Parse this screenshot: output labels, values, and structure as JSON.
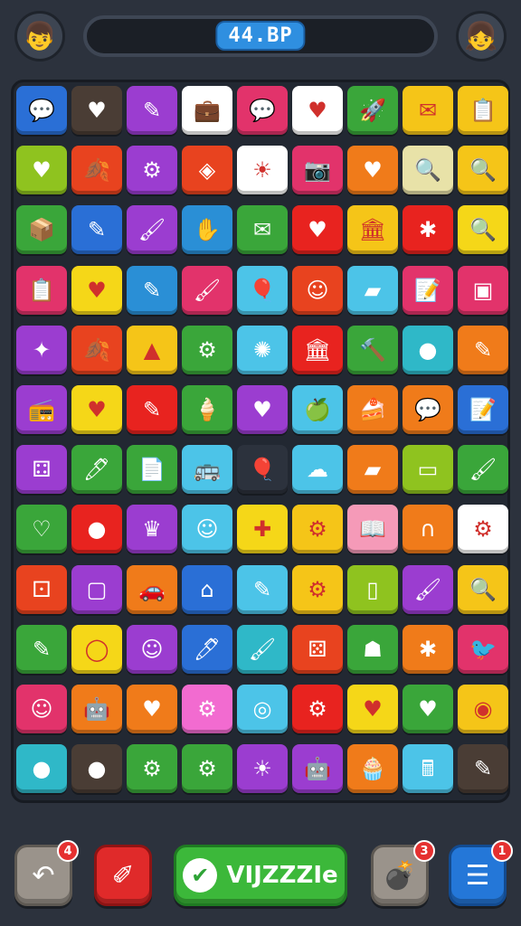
{
  "header": {
    "score": "44.BP",
    "left_avatar": "boy-avatar",
    "right_avatar": "girl-avatar"
  },
  "board": {
    "rows": [
      [
        {
          "color": "#2a6fd6",
          "icon": "speech-bubble-icon",
          "glyph": "💬"
        },
        {
          "color": "#4a3d35",
          "icon": "heart-icon",
          "glyph": "♥"
        },
        {
          "color": "#9b3dd0",
          "icon": "pencil-icon",
          "glyph": "✎"
        },
        {
          "color": "#ffffff",
          "icon": "briefcase-icon",
          "glyph": "💼"
        },
        {
          "color": "#e2336b",
          "icon": "speech-bubble-icon",
          "glyph": "💬"
        },
        {
          "color": "#ffffff",
          "icon": "heart-icon",
          "glyph": "♥"
        },
        {
          "color": "#3aa63a",
          "icon": "rocket-icon",
          "glyph": "🚀"
        },
        {
          "color": "#f5c518",
          "icon": "envelope-icon",
          "glyph": "✉"
        },
        {
          "color": "#f5c518",
          "icon": "clipboard-icon",
          "glyph": "📋"
        }
      ],
      [
        {
          "color": "#8fc31f",
          "icon": "heart-icon",
          "glyph": "♥"
        },
        {
          "color": "#e8431f",
          "icon": "leaf-icon",
          "glyph": "🍂"
        },
        {
          "color": "#9b3dd0",
          "icon": "gear-icon",
          "glyph": "⚙"
        },
        {
          "color": "#e8431f",
          "icon": "kite-icon",
          "glyph": "◈"
        },
        {
          "color": "#ffffff",
          "icon": "sun-icon",
          "glyph": "☀"
        },
        {
          "color": "#e2336b",
          "icon": "camera-icon",
          "glyph": "📷"
        },
        {
          "color": "#f07b1a",
          "icon": "heart-icon",
          "glyph": "♥"
        },
        {
          "color": "#e8e2a8",
          "icon": "magnifier-icon",
          "glyph": "🔍"
        },
        {
          "color": "#f5c518",
          "icon": "magnifier-icon",
          "glyph": "🔍"
        }
      ],
      [
        {
          "color": "#3aa63a",
          "icon": "box-icon",
          "glyph": "📦"
        },
        {
          "color": "#2a6fd6",
          "icon": "pencil-icon",
          "glyph": "✎"
        },
        {
          "color": "#9b3dd0",
          "icon": "brush-icon",
          "glyph": "🖌"
        },
        {
          "color": "#2a8fd6",
          "icon": "hand-icon",
          "glyph": "✋"
        },
        {
          "color": "#3aa63a",
          "icon": "envelope-icon",
          "glyph": "✉"
        },
        {
          "color": "#e8231f",
          "icon": "heart-icon",
          "glyph": "♥"
        },
        {
          "color": "#f5c518",
          "icon": "building-icon",
          "glyph": "🏛"
        },
        {
          "color": "#e8231f",
          "icon": "bug-icon",
          "glyph": "✱"
        },
        {
          "color": "#f5d718",
          "icon": "magnifier-icon",
          "glyph": "🔍"
        }
      ],
      [
        {
          "color": "#e2336b",
          "icon": "clipboard-icon",
          "glyph": "📋"
        },
        {
          "color": "#f5d718",
          "icon": "heart-icon",
          "glyph": "♥"
        },
        {
          "color": "#2a8fd6",
          "icon": "pencil-icon",
          "glyph": "✎"
        },
        {
          "color": "#e2336b",
          "icon": "brush-icon",
          "glyph": "🖌"
        },
        {
          "color": "#4cc4e8",
          "icon": "balloon-icon",
          "glyph": "🎈"
        },
        {
          "color": "#e8431f",
          "icon": "smiley-icon",
          "glyph": "☺"
        },
        {
          "color": "#4cc4e8",
          "icon": "eraser-icon",
          "glyph": "▰"
        },
        {
          "color": "#e2336b",
          "icon": "note-icon",
          "glyph": "📝"
        },
        {
          "color": "#e2336b",
          "icon": "card-icon",
          "glyph": "▣"
        }
      ],
      [
        {
          "color": "#9b3dd0",
          "icon": "star-burst-icon",
          "glyph": "✦"
        },
        {
          "color": "#e8431f",
          "icon": "leaf-icon",
          "glyph": "🍂"
        },
        {
          "color": "#f5c518",
          "icon": "horn-icon",
          "glyph": "▲"
        },
        {
          "color": "#3aa63a",
          "icon": "gear-icon",
          "glyph": "⚙"
        },
        {
          "color": "#4cc4e8",
          "icon": "satellite-icon",
          "glyph": "✺"
        },
        {
          "color": "#e8231f",
          "icon": "building-icon",
          "glyph": "🏛"
        },
        {
          "color": "#3aa63a",
          "icon": "hammer-icon",
          "glyph": "🔨"
        },
        {
          "color": "#2fb8c8",
          "icon": "lime-icon",
          "glyph": "●"
        },
        {
          "color": "#f07b1a",
          "icon": "pencil-icon",
          "glyph": "✎"
        }
      ],
      [
        {
          "color": "#9b3dd0",
          "icon": "radio-icon",
          "glyph": "📻"
        },
        {
          "color": "#f5d718",
          "icon": "heart-icon",
          "glyph": "♥"
        },
        {
          "color": "#e8231f",
          "icon": "pencil-icon",
          "glyph": "✎"
        },
        {
          "color": "#3aa63a",
          "icon": "popsicle-icon",
          "glyph": "🍦"
        },
        {
          "color": "#9b3dd0",
          "icon": "heart-icon",
          "glyph": "♥"
        },
        {
          "color": "#4cc4e8",
          "icon": "apple-icon",
          "glyph": "🍏"
        },
        {
          "color": "#f07b1a",
          "icon": "cake-icon",
          "glyph": "🍰"
        },
        {
          "color": "#f07b1a",
          "icon": "speech-bubble-icon",
          "glyph": "💬"
        },
        {
          "color": "#2a6fd6",
          "icon": "note-icon",
          "glyph": "📝"
        }
      ],
      [
        {
          "color": "#9b3dd0",
          "icon": "dice-icon",
          "glyph": "⚃"
        },
        {
          "color": "#3aa63a",
          "icon": "marker-icon",
          "glyph": "🖊"
        },
        {
          "color": "#3aa63a",
          "icon": "document-icon",
          "glyph": "📄"
        },
        {
          "color": "#4cc4e8",
          "icon": "bus-icon",
          "glyph": "🚌"
        },
        {
          "color": "#2c323d",
          "icon": "balloon-icon",
          "glyph": "🎈"
        },
        {
          "color": "#4cc4e8",
          "icon": "cloud-icon",
          "glyph": "☁"
        },
        {
          "color": "#f07b1a",
          "icon": "eraser-icon",
          "glyph": "▰"
        },
        {
          "color": "#8fc31f",
          "icon": "bandage-icon",
          "glyph": "▭"
        },
        {
          "color": "#3aa63a",
          "icon": "brush-icon",
          "glyph": "🖌"
        }
      ],
      [
        {
          "color": "#3aa63a",
          "icon": "heart-icon",
          "glyph": "♡"
        },
        {
          "color": "#e8231f",
          "icon": "circle-icon",
          "glyph": "●"
        },
        {
          "color": "#9b3dd0",
          "icon": "crown-icon",
          "glyph": "♛"
        },
        {
          "color": "#4cc4e8",
          "icon": "ghost-icon",
          "glyph": "☺"
        },
        {
          "color": "#f5d718",
          "icon": "puzzle-icon",
          "glyph": "✚"
        },
        {
          "color": "#f5c518",
          "icon": "gear-icon",
          "glyph": "⚙"
        },
        {
          "color": "#f59ab8",
          "icon": "book-icon",
          "glyph": "📖"
        },
        {
          "color": "#f07b1a",
          "icon": "magnet-icon",
          "glyph": "∩"
        },
        {
          "color": "#ffffff",
          "icon": "gear-icon",
          "glyph": "⚙"
        }
      ],
      [
        {
          "color": "#e8431f",
          "icon": "dice-icon",
          "glyph": "⚀"
        },
        {
          "color": "#9b3dd0",
          "icon": "jar-icon",
          "glyph": "▢"
        },
        {
          "color": "#f07b1a",
          "icon": "car-icon",
          "glyph": "🚗"
        },
        {
          "color": "#2a6fd6",
          "icon": "house-icon",
          "glyph": "⌂"
        },
        {
          "color": "#4cc4e8",
          "icon": "pencil-icon",
          "glyph": "✎"
        },
        {
          "color": "#f5c518",
          "icon": "gear-icon",
          "glyph": "⚙"
        },
        {
          "color": "#8fc31f",
          "icon": "bottle-icon",
          "glyph": "▯"
        },
        {
          "color": "#9b3dd0",
          "icon": "brush-icon",
          "glyph": "🖌"
        },
        {
          "color": "#f5c518",
          "icon": "magnifier-icon",
          "glyph": "🔍"
        }
      ],
      [
        {
          "color": "#3aa63a",
          "icon": "pencil-icon",
          "glyph": "✎"
        },
        {
          "color": "#f5d718",
          "icon": "balloon-icon",
          "glyph": "◯"
        },
        {
          "color": "#9b3dd0",
          "icon": "smiley-icon",
          "glyph": "☺"
        },
        {
          "color": "#2a6fd6",
          "icon": "marker-icon",
          "glyph": "🖊"
        },
        {
          "color": "#2fb8c8",
          "icon": "brush-icon",
          "glyph": "🖌"
        },
        {
          "color": "#e8431f",
          "icon": "dice-icon",
          "glyph": "⚄"
        },
        {
          "color": "#3aa63a",
          "icon": "monster-icon",
          "glyph": "☗"
        },
        {
          "color": "#f07b1a",
          "icon": "bug-icon",
          "glyph": "✱"
        },
        {
          "color": "#e2336b",
          "icon": "bird-icon",
          "glyph": "🐦"
        }
      ],
      [
        {
          "color": "#e2336b",
          "icon": "smiley-icon",
          "glyph": "☺"
        },
        {
          "color": "#f07b1a",
          "icon": "robot-icon",
          "glyph": "🤖"
        },
        {
          "color": "#f07b1a",
          "icon": "heart-icon",
          "glyph": "♥"
        },
        {
          "color": "#f26bd0",
          "icon": "gear-icon",
          "glyph": "⚙"
        },
        {
          "color": "#4cc4e8",
          "icon": "ring-icon",
          "glyph": "◎"
        },
        {
          "color": "#e8231f",
          "icon": "gear-icon",
          "glyph": "⚙"
        },
        {
          "color": "#f5d718",
          "icon": "heart-icon",
          "glyph": "♥"
        },
        {
          "color": "#3aa63a",
          "icon": "heart-icon",
          "glyph": "♥"
        },
        {
          "color": "#f5c518",
          "icon": "donut-icon",
          "glyph": "◉"
        }
      ],
      [
        {
          "color": "#2fb8c8",
          "icon": "apple-icon",
          "glyph": "●"
        },
        {
          "color": "#4a3d35",
          "icon": "apple-icon",
          "glyph": "●"
        },
        {
          "color": "#3aa63a",
          "icon": "gear-icon",
          "glyph": "⚙"
        },
        {
          "color": "#3aa63a",
          "icon": "gear-icon",
          "glyph": "⚙"
        },
        {
          "color": "#9b3dd0",
          "icon": "sun-icon",
          "glyph": "☀"
        },
        {
          "color": "#9b3dd0",
          "icon": "robot-icon",
          "glyph": "🤖"
        },
        {
          "color": "#f07b1a",
          "icon": "cupcake-icon",
          "glyph": "🧁"
        },
        {
          "color": "#4cc4e8",
          "icon": "calculator-icon",
          "glyph": "🖩"
        },
        {
          "color": "#4a3d35",
          "icon": "pencil-icon",
          "glyph": "✎"
        }
      ]
    ]
  },
  "toolbar": {
    "main_label": "VIJZZZIe",
    "undo_count": "4",
    "bomb_count": "3",
    "menu_count": "1"
  }
}
